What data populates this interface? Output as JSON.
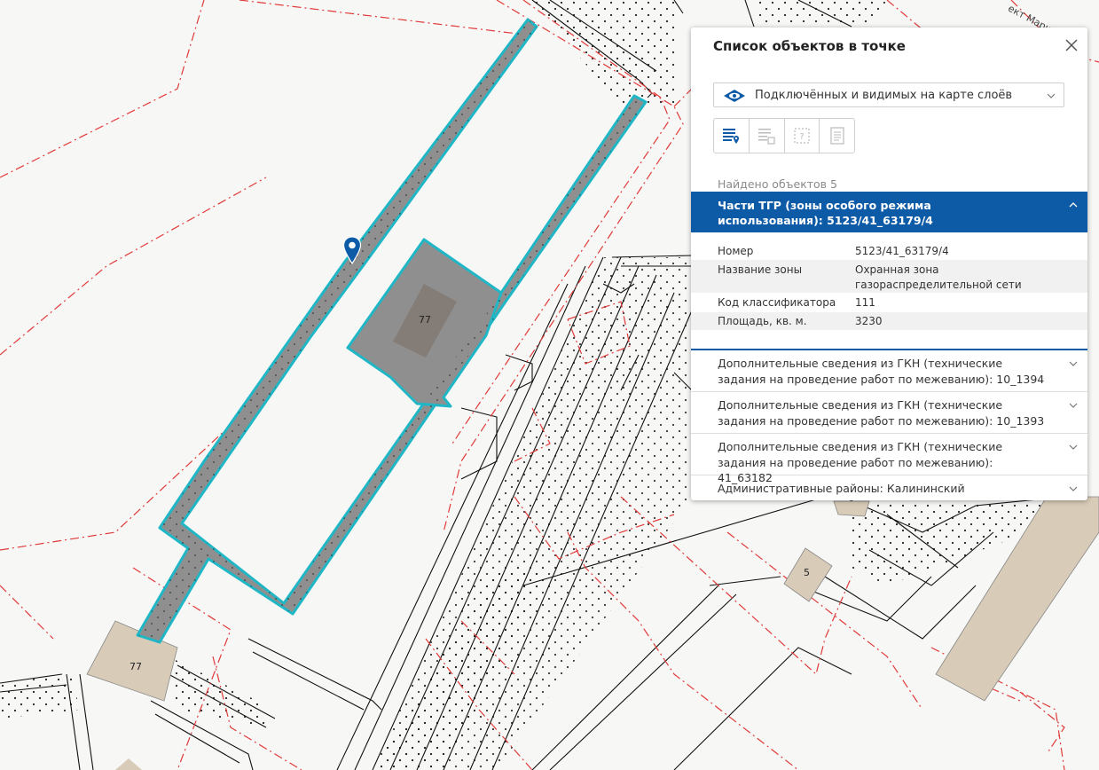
{
  "map": {
    "parcel_labels": [
      "77",
      "77",
      "5"
    ],
    "street_label": "ект Марша"
  },
  "panel": {
    "title": "Список объектов в точке",
    "layer_selector": "Подключённых и видимых на карте слоёв",
    "mode_buttons": [
      "objects-at-point-icon",
      "layer-list-icon",
      "help-frame-icon",
      "document-icon"
    ],
    "found_text": "Найдено объектов 5",
    "active_item": {
      "title": "Части ТГР (зоны особого режима использования): 5123/41_63179/4",
      "properties": [
        {
          "key": "Номер",
          "value": "5123/41_63179/4"
        },
        {
          "key": "Название зоны",
          "value": "Охранная зона газораспределительной сети"
        },
        {
          "key": "Код классификатора",
          "value": "111"
        },
        {
          "key": "Площадь, кв. м.",
          "value": "3230"
        }
      ]
    },
    "collapsed_items": [
      "Дополнительные сведения из ГКН (технические задания на проведение работ по межеванию): 10_1394",
      "Дополнительные сведения из ГКН (технические задания на проведение работ по межеванию): 10_1393",
      "Дополнительные сведения из ГКН (технические задания на проведение работ по межеванию): 41_63182",
      "Административные районы: Калининский"
    ]
  },
  "colors": {
    "accent": "#0d5aa7",
    "highlight": "#1fb6c6",
    "zone_fill": "#8f8f8f",
    "parcel_fill": "#d8cbb8",
    "red_dash": "#e03a3a"
  }
}
